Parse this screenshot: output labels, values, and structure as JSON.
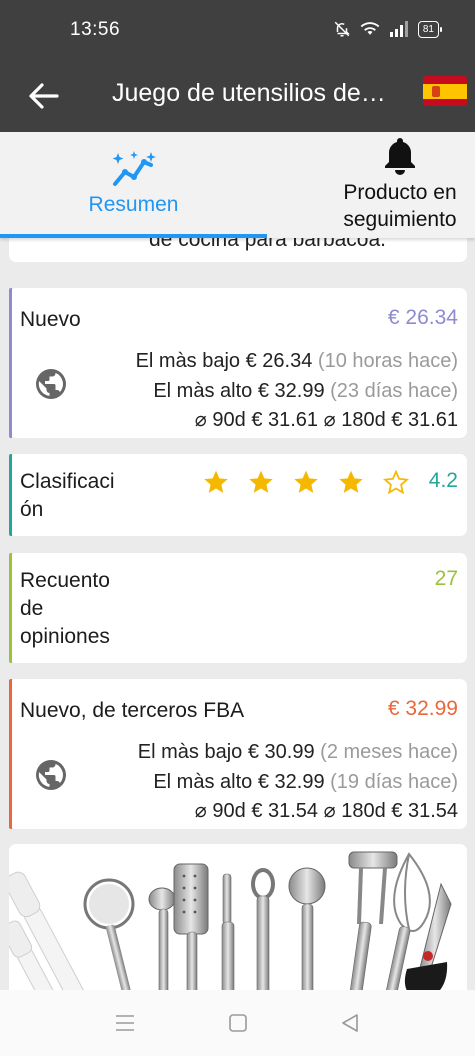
{
  "status_bar": {
    "time": "13:56",
    "battery": "81"
  },
  "app_bar": {
    "title": "Juego de utensilios de…",
    "back_icon": "arrow-left-icon",
    "flag_icon": "spain-flag-icon"
  },
  "tabs": [
    {
      "label": "Resumen",
      "icon": "sparkle-chart-icon",
      "active": true
    },
    {
      "label": "Producto en seguimiento",
      "icon": "bell-icon",
      "active": false
    }
  ],
  "colors": {
    "accent_blue": "#2196f3",
    "new": "#8e8bd0",
    "rating": "#26a69a",
    "reviews": "#9cc23a",
    "fba": "#e8683c",
    "star": "#f5b800"
  },
  "top_card": {
    "text": "de cocina para barbacoa."
  },
  "price_new": {
    "title": "Nuevo",
    "value": "€ 26.34",
    "lowest_label": "El màs bajo",
    "lowest_value": "€ 26.34",
    "lowest_when": "(10 horas hace)",
    "highest_label": "El màs alto",
    "highest_value": "€ 32.99",
    "highest_when": "(23 días hace)",
    "avg90_label": "⌀ 90d",
    "avg90_value": "€ 31.61",
    "avg180_label": "⌀ 180d",
    "avg180_value": "€ 31.61"
  },
  "rating": {
    "title": "Clasificaci ón",
    "title_line1": "Clasificaci",
    "title_line2": "ón",
    "value": "4.2",
    "stars_filled": 4,
    "stars_total": 5
  },
  "reviews": {
    "title_line1": "Recuento",
    "title_line2": "de",
    "title_line3": "opiniones",
    "value": "27"
  },
  "price_fba": {
    "title": "Nuevo, de terceros FBA",
    "value": "€ 32.99",
    "lowest_label": "El màs bajo",
    "lowest_value": "€ 30.99",
    "lowest_when": "(2 meses hace)",
    "highest_label": "El màs alto",
    "highest_value": "€ 32.99",
    "highest_when": "(19 días hace)",
    "avg90_label": "⌀ 90d",
    "avg90_value": "€ 31.54",
    "avg180_label": "⌀ 180d",
    "avg180_value": "€ 31.54"
  },
  "nav": {
    "recents_icon": "menu-icon",
    "home_icon": "square-home-icon",
    "back_icon": "triangle-back-icon"
  }
}
